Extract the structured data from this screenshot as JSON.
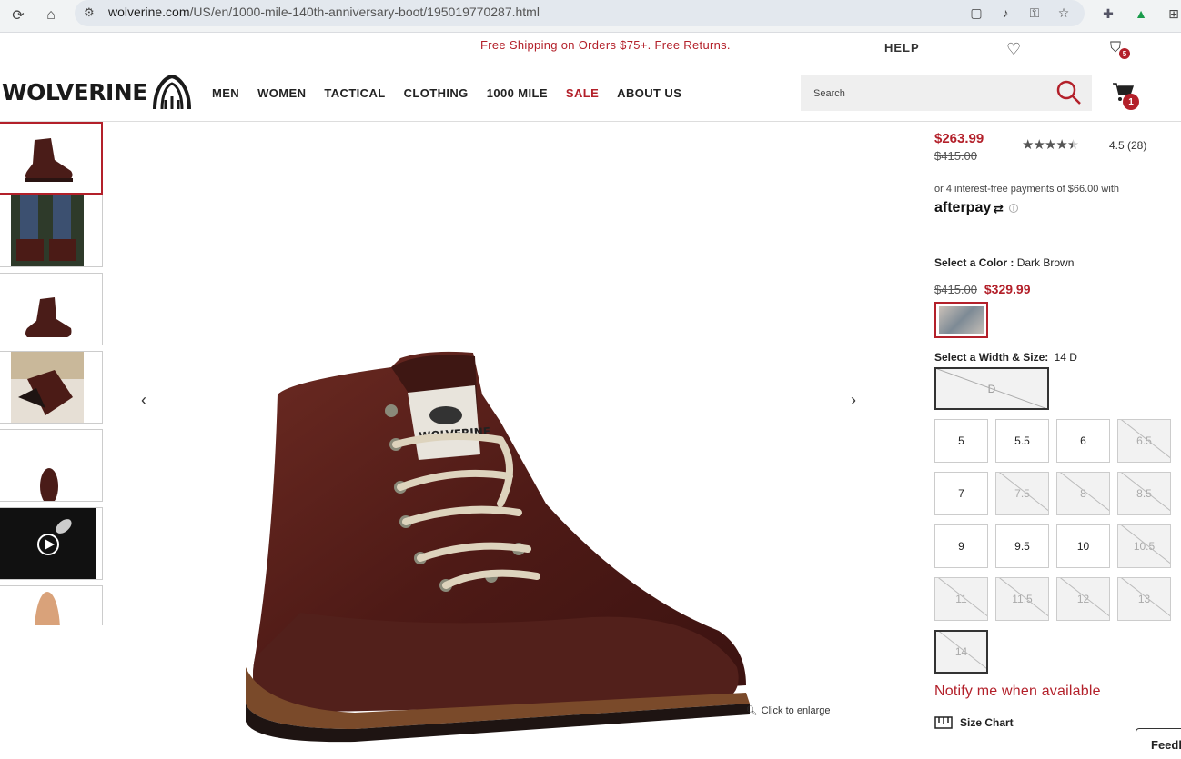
{
  "browser": {
    "url_host": "wolverine.com",
    "url_path": "/US/en/1000-mile-140th-anniversary-boot/195019770287.html"
  },
  "promo": {
    "text": "Free Shipping on Orders $75+. Free Returns.",
    "help_label": "HELP",
    "notifications_count": "5"
  },
  "header": {
    "logo_text": "WOLVERINE",
    "nav": [
      "MEN",
      "WOMEN",
      "TACTICAL",
      "CLOTHING",
      "1000 MILE",
      "SALE",
      "ABOUT US"
    ],
    "search_placeholder": "Search",
    "cart_count": "1"
  },
  "gallery": {
    "enlarge_label": "Click to enlarge"
  },
  "product": {
    "price_now": "$263.99",
    "price_was": "$415.00",
    "rating_value": 4.5,
    "rating_text": "4.5 (28)",
    "afterpay_text": "or 4 interest-free payments of $66.00 with",
    "afterpay_logo": "afterpay",
    "color_label": "Select a Color :",
    "color_value": "Dark Brown",
    "color_price_was": "$415.00",
    "color_price_now": "$329.99",
    "size_label": "Select a Width & Size:",
    "size_value": "14 D",
    "width": "D",
    "sizes": [
      {
        "label": "5",
        "available": true
      },
      {
        "label": "5.5",
        "available": true
      },
      {
        "label": "6",
        "available": true
      },
      {
        "label": "6.5",
        "available": false
      },
      {
        "label": "7",
        "available": true
      },
      {
        "label": "7.5",
        "available": false
      },
      {
        "label": "8",
        "available": false
      },
      {
        "label": "8.5",
        "available": false
      },
      {
        "label": "9",
        "available": true
      },
      {
        "label": "9.5",
        "available": true
      },
      {
        "label": "10",
        "available": true
      },
      {
        "label": "10.5",
        "available": false
      },
      {
        "label": "11",
        "available": false
      },
      {
        "label": "11.5",
        "available": false
      },
      {
        "label": "12",
        "available": false
      },
      {
        "label": "13",
        "available": false
      },
      {
        "label": "14",
        "available": false,
        "selected": true
      }
    ],
    "notify_label": "Notify me when available",
    "size_chart_label": "Size Chart"
  },
  "feedback_label": "Feedback",
  "colors": {
    "brand_red": "#b3202a",
    "leather": "#5a1e1a"
  }
}
